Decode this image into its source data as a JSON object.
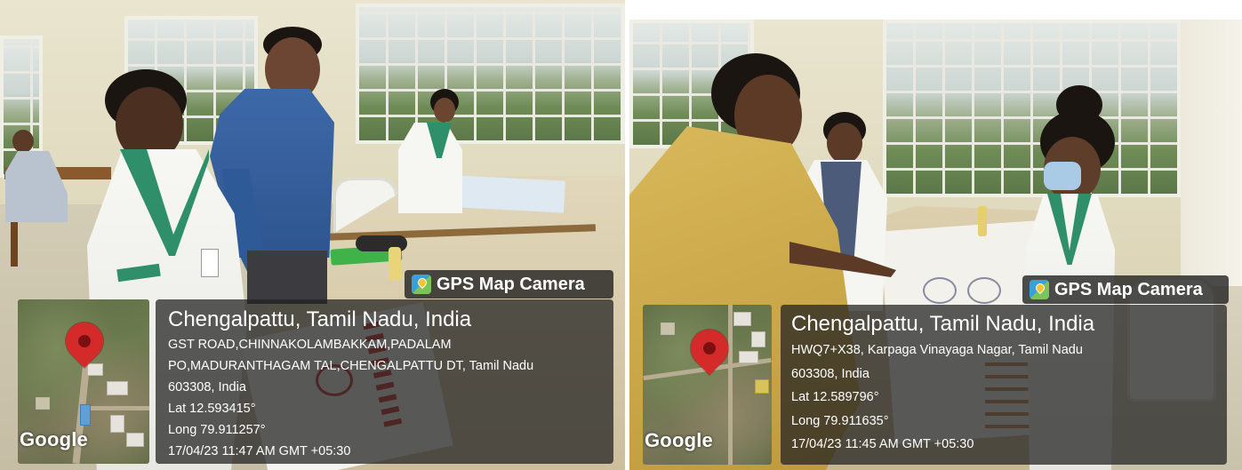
{
  "photos": [
    {
      "badge": {
        "icon": "gps-map-camera-icon",
        "label": "GPS Map Camera"
      },
      "map": {
        "watermark": "Google",
        "pin_icon": "map-pin-icon",
        "pin_color": "#d42a2a"
      },
      "location_title": "Chengalpattu, Tamil Nadu, India",
      "address_lines": [
        "GST ROAD,CHINNAKOLAMBAKKAM,PADALAM",
        "PO,MADURANTHAGAM TAL,CHENGALPATTU DT, Tamil Nadu",
        "603308, India"
      ],
      "lat": "Lat 12.593415°",
      "long": "Long 79.911257°",
      "timestamp": "17/04/23 11:47 AM GMT +05:30"
    },
    {
      "badge": {
        "icon": "gps-map-camera-icon",
        "label": "GPS Map Camera"
      },
      "map": {
        "watermark": "Google",
        "pin_icon": "map-pin-icon",
        "pin_color": "#d42a2a"
      },
      "location_title": "Chengalpattu, Tamil Nadu, India",
      "address_lines": [
        "HWQ7+X38, Karpaga Vinayaga Nagar, Tamil Nadu",
        "603308, India"
      ],
      "lat": "Lat 12.589796°",
      "long": "Long 79.911635°",
      "timestamp": "17/04/23 11:45 AM GMT +05:30"
    }
  ]
}
